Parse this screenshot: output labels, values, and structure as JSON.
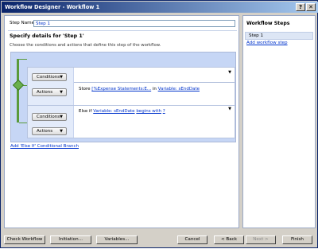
{
  "window": {
    "title": "Workflow Designer - Workflow 1",
    "help_glyph": "?",
    "close_glyph": "✕"
  },
  "step": {
    "name_label": "Step Name:",
    "name_value": "Step 1",
    "details_title": "Specify details for 'Step 1'",
    "details_subtitle": "Choose the conditions and actions that define this step of the workflow."
  },
  "branch1": {
    "conditions_label": "Conditions",
    "actions_label": "Actions",
    "action_prefix": "Store",
    "action_link1": "[%Expense Statements:E...",
    "action_mid": "in",
    "action_link2": "Variable: sEndDate",
    "dropmark": "▼"
  },
  "branch2": {
    "conditions_label": "Conditions",
    "actions_label": "Actions",
    "else_prefix": "Else if",
    "else_link1": "Variable: sEndDate",
    "else_link2": "begins with",
    "else_link3": "?",
    "dropmark": "▼"
  },
  "add_branch_label": "Add 'Else If' Conditional Branch",
  "sidebar": {
    "title": "Workflow Steps",
    "steps": [
      "Step 1"
    ],
    "add_step_label": "Add workflow step"
  },
  "footer": {
    "check_workflow": "Check Workflow",
    "initiation": "Initiation...",
    "variables": "Variables...",
    "cancel": "Cancel",
    "back": "< Back",
    "next": "Next >",
    "finish": "Finish"
  },
  "caret_glyph": "▼"
}
